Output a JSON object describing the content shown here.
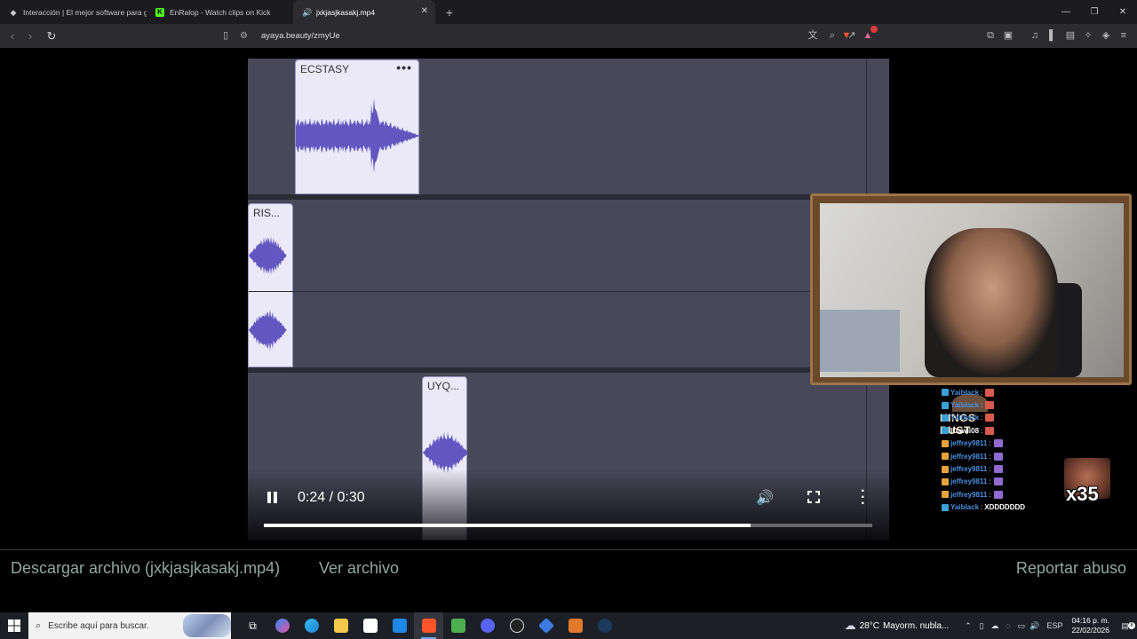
{
  "browser": {
    "tabs": [
      {
        "label": "Interacción | El mejor software para g",
        "icon": "diamond-icon"
      },
      {
        "label": "EnRalop - Watch clips on Kick",
        "icon": "kick-icon"
      },
      {
        "label": "jxkjasjkasakj.mp4",
        "icon": "audio-icon",
        "active": true
      }
    ],
    "url": "ayaya.beauty/zmyUe"
  },
  "video": {
    "clips": {
      "clip1": "ECSTASY",
      "clip2": "RIS...",
      "clip3": "UYQ..."
    },
    "clip_menu": "•••",
    "time_display": "0:24 / 0:30",
    "progress": 0.8,
    "waveform_color": "#6356c0"
  },
  "stream": {
    "logo_text": "KINGS RUST",
    "chat": [
      {
        "name": "Yaiblack",
        "sep": ":",
        "msg": "",
        "color": "#4a90e2"
      },
      {
        "name": "Yaiblack",
        "sep": ":",
        "msg": "",
        "color": "#4a90e2"
      },
      {
        "name": "Yaiblack",
        "sep": ":",
        "msg": "",
        "color": "#4a90e2"
      },
      {
        "name": "IDawli08",
        "sep": ":",
        "msg": "",
        "color": "#ffffff"
      },
      {
        "name": "jeffrey9811",
        "sep": ":",
        "msg": "",
        "color": "#4a90e2"
      },
      {
        "name": "jeffrey9811",
        "sep": ":",
        "msg": "",
        "color": "#4a90e2"
      },
      {
        "name": "jeffrey9811",
        "sep": ":",
        "msg": "",
        "color": "#4a90e2"
      },
      {
        "name": "jeffrey9811",
        "sep": ":",
        "msg": "",
        "color": "#4a90e2"
      },
      {
        "name": "jeffrey9811",
        "sep": ":",
        "msg": "",
        "color": "#4a90e2"
      },
      {
        "name": "Yaiblack",
        "sep": ":",
        "msg": "XDDDDDDD",
        "color": "#4a90e2"
      }
    ],
    "emote_count": "x35"
  },
  "page": {
    "download_link": "Descargar archivo (jxkjasjkasakj.mp4)",
    "view_link": "Ver archivo",
    "report_link": "Reportar abuso"
  },
  "taskbar": {
    "search_placeholder": "Escribe aquí para buscar.",
    "weather_temp": "28°C",
    "weather_text": "Mayorm. nubla...",
    "language": "ESP",
    "time": "04:16 p. m.",
    "date": "22/02/2026",
    "notification_count": "8"
  }
}
